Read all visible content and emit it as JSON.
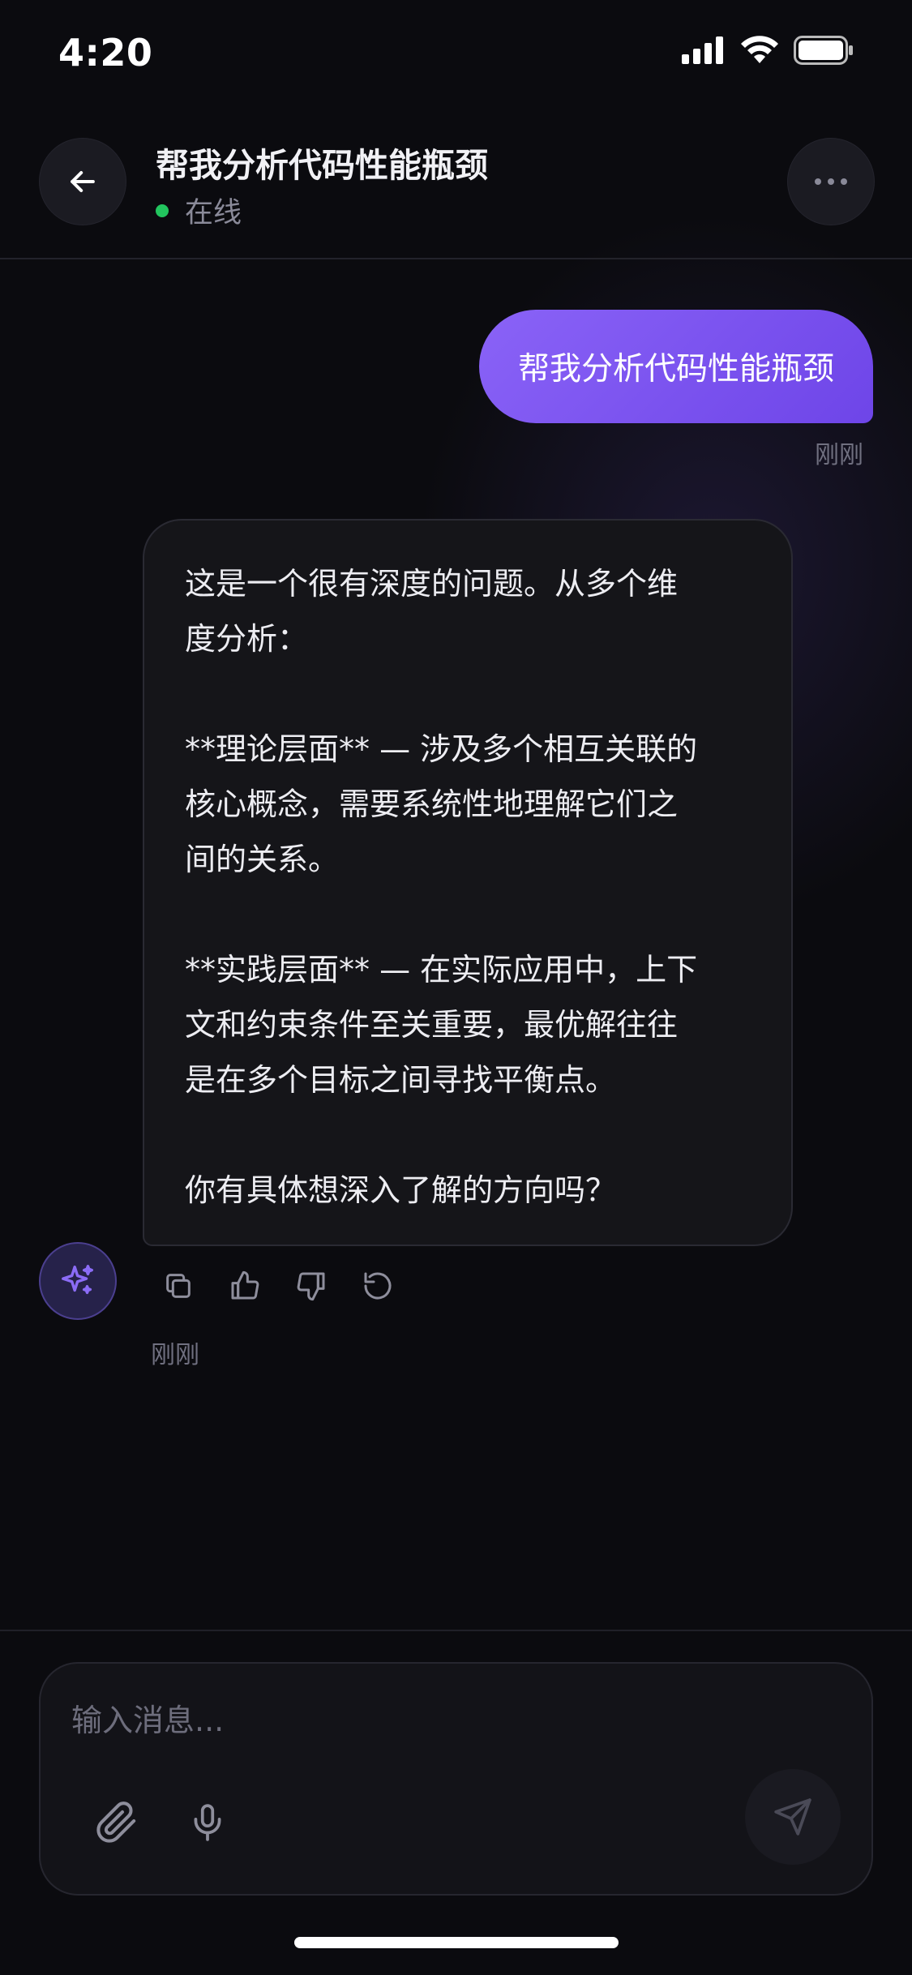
{
  "status_bar": {
    "time": "4:20"
  },
  "header": {
    "title": "帮我分析代码性能瓶颈",
    "status": "在线"
  },
  "messages": {
    "user": {
      "text": "帮我分析代码性能瓶颈",
      "time": "刚刚"
    },
    "assistant": {
      "lines": [
        "这是一个很有深度的问题。从多个维",
        "度分析：",
        "",
        "**理论层面** — 涉及多个相互关联的",
        "核心概念，需要系统性地理解它们之",
        "间的关系。",
        "",
        "**实践层面** — 在实际应用中，上下",
        "文和约束条件至关重要，最优解往往",
        "是在多个目标之间寻找平衡点。",
        "",
        "你有具体想深入了解的方向吗？"
      ],
      "time": "刚刚"
    }
  },
  "composer": {
    "placeholder": "输入消息..."
  },
  "colors": {
    "background": "#0b0b0f",
    "accent": "#7c56f2",
    "online": "#22c55e",
    "bubble": "#151519"
  },
  "icons": {
    "back": "arrow-left-icon",
    "more": "more-horizontal-icon",
    "avatar": "sparkles-icon",
    "copy": "copy-icon",
    "like": "thumbs-up-icon",
    "dislike": "thumbs-down-icon",
    "regenerate": "refresh-icon",
    "attach": "paperclip-icon",
    "mic": "microphone-icon",
    "send": "send-icon"
  }
}
